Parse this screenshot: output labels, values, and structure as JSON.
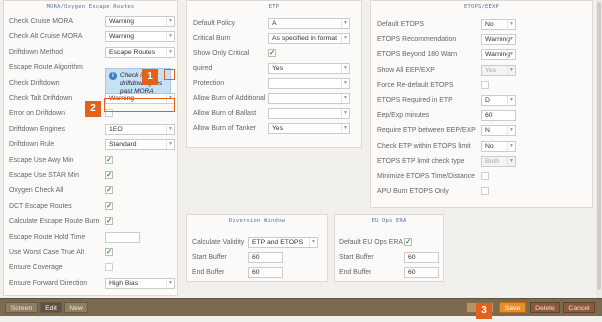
{
  "mora": {
    "title": "MORA/Oxygen Escape Routes",
    "rows": [
      {
        "label": "Check Cruise MORA",
        "type": "select",
        "value": "Warning"
      },
      {
        "label": "Check Alt Cruise MORA",
        "type": "select",
        "value": "Warning"
      },
      {
        "label": "Driftdown Method",
        "type": "select",
        "value": "Escape Routes"
      },
      {
        "label": "Escape Route Algorithm",
        "type": "none",
        "value": ""
      },
      {
        "label": "Check Driftdown",
        "type": "none",
        "value": ""
      },
      {
        "label": "Check Talt Driftdown",
        "type": "select",
        "value": "Warning"
      },
      {
        "label": "Error on Driftdown",
        "type": "checkbox",
        "value": ""
      },
      {
        "label": "Driftdown Engines",
        "type": "select",
        "value": "1EO"
      },
      {
        "label": "Driftdown Rule",
        "type": "select",
        "value": "Standard"
      },
      {
        "label": "Escape Use Awy Min",
        "type": "checkbox",
        "value": "✓"
      },
      {
        "label": "Escape Use STAR Min",
        "type": "checkbox",
        "value": "✓"
      },
      {
        "label": "Oxygen Check All",
        "type": "checkbox",
        "value": "✓"
      },
      {
        "label": "DCT Escape Routes",
        "type": "checkbox",
        "value": "✓"
      },
      {
        "label": "Calculate Escape Route Burn",
        "type": "checkbox",
        "value": "✓"
      },
      {
        "label": "Escape Route Hold Time",
        "type": "text",
        "value": ""
      },
      {
        "label": "Use Worst Case True Alt",
        "type": "checkbox",
        "value": "✓"
      },
      {
        "label": "Ensure Coverage",
        "type": "checkbox",
        "value": ""
      },
      {
        "label": "Ensure Forward Direction",
        "type": "select",
        "value": "High Bias"
      }
    ]
  },
  "tooltip": {
    "text": "Check if driftdown goes past MORA",
    "icon": "info-icon"
  },
  "etp": {
    "title": "ETP",
    "rows": [
      {
        "label": "Default Policy",
        "type": "select",
        "value": "A"
      },
      {
        "label": "Critical Burn",
        "type": "select",
        "value": "As specified in format"
      },
      {
        "label": "Show Only Critical",
        "type": "checkbox",
        "value": "✓"
      },
      {
        "label": "quired",
        "type": "select",
        "value": "Yes"
      },
      {
        "label": "Protection",
        "type": "select",
        "value": ""
      },
      {
        "label": "Allow Burn of Additional",
        "type": "select",
        "value": ""
      },
      {
        "label": "Allow Burn of Ballast",
        "type": "select",
        "value": ""
      },
      {
        "label": "Allow Burn of Tanker",
        "type": "select",
        "value": "Yes"
      }
    ]
  },
  "etops": {
    "title": "ETOPS/EEXP",
    "rows": [
      {
        "label": "Default ETOPS",
        "type": "select",
        "value": "No",
        "disabled": false
      },
      {
        "label": "ETOPS Recommendation",
        "type": "select",
        "value": "Warning",
        "disabled": false
      },
      {
        "label": "ETOPS Beyond 180 Warn",
        "type": "select",
        "value": "Warning",
        "disabled": false
      },
      {
        "label": "Show All EEP/EXP",
        "type": "select",
        "value": "Yes",
        "disabled": true
      },
      {
        "label": "Force Re-default ETOPS",
        "type": "checkbox",
        "value": ""
      },
      {
        "label": "ETOPS Required in ETP",
        "type": "select",
        "value": "D",
        "disabled": false
      },
      {
        "label": "Eep/Exp minutes",
        "type": "text",
        "value": "60"
      },
      {
        "label": "Require ETP between EEP/EXP",
        "type": "select",
        "value": "N",
        "disabled": false
      },
      {
        "label": "Check ETP within ETOPS limit",
        "type": "select",
        "value": "No",
        "disabled": false
      },
      {
        "label": "ETOPS ETP limit check type",
        "type": "select",
        "value": "Both",
        "disabled": true
      },
      {
        "label": "Minimize ETOPS Time/Distance",
        "type": "checkbox",
        "value": ""
      },
      {
        "label": "APU Burn ETOPS Only",
        "type": "checkbox",
        "value": ""
      }
    ]
  },
  "diversion": {
    "title": "Diversion Window",
    "rows": [
      {
        "label": "Calculate Validity",
        "type": "select",
        "value": "ETP and ETOPS"
      },
      {
        "label": "Start Buffer",
        "type": "text",
        "value": "60"
      },
      {
        "label": "End Buffer",
        "type": "text",
        "value": "60"
      }
    ]
  },
  "euops": {
    "title": "EU Ops ERA",
    "rows": [
      {
        "label": "Default EU Ops ERA",
        "type": "checkbox",
        "value": "✓"
      },
      {
        "label": "Start Buffer",
        "type": "text",
        "value": "60"
      },
      {
        "label": "End Buffer",
        "type": "text",
        "value": "60"
      }
    ]
  },
  "toolbar": {
    "screen": "Screen",
    "edit": "Edit",
    "new": "New",
    "save": "Save",
    "delete": "Delete",
    "cancel": "Cancel"
  },
  "markers": [
    "1",
    "2",
    "3"
  ],
  "colors": {
    "accent": "#e2621b",
    "save": "#e98f2a",
    "check": "#3d9a2c",
    "toolbar": "#7a6a52"
  }
}
